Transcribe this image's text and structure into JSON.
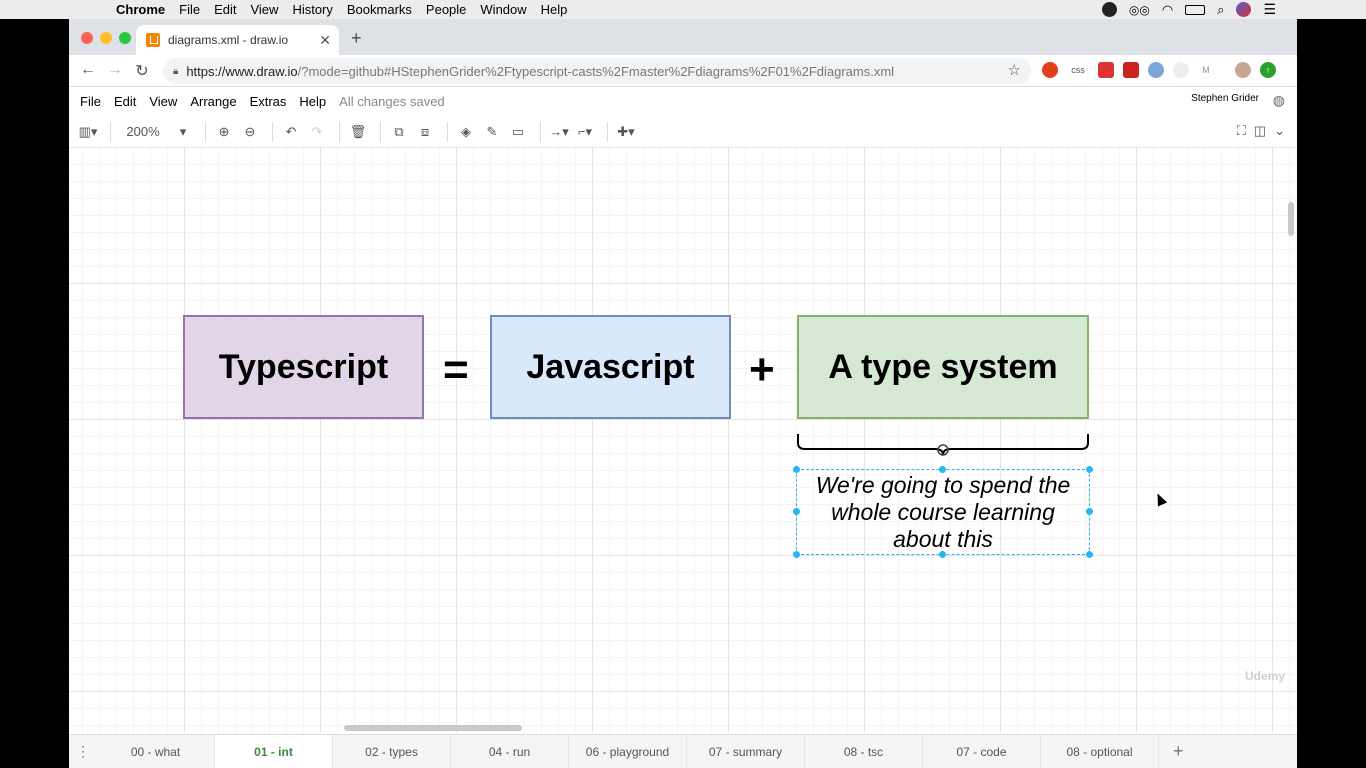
{
  "os_menubar": {
    "app": "Chrome",
    "items": [
      "File",
      "Edit",
      "View",
      "History",
      "Bookmarks",
      "People",
      "Window",
      "Help"
    ]
  },
  "browser": {
    "tab_title": "diagrams.xml - draw.io",
    "url_host": "https://www.draw.io",
    "url_rest": "/?mode=github#HStephenGrider%2Ftypescript-casts%2Fmaster%2Fdiagrams%2F01%2Fdiagrams.xml"
  },
  "drawio": {
    "menu": [
      "File",
      "Edit",
      "View",
      "Arrange",
      "Extras",
      "Help"
    ],
    "status": "All changes saved",
    "user": "Stephen Grider",
    "zoom": "200%"
  },
  "diagram": {
    "box1": "Typescript",
    "eq": "=",
    "box2": "Javascript",
    "plus": "+",
    "box3": "A type system",
    "note_line1": "We're going to spend the",
    "note_line2": "whole course learning",
    "note_line3": "about this",
    "colors": {
      "ts_fill": "#e1d5e7",
      "ts_stroke": "#9673a6",
      "js_fill": "#dae8fc",
      "js_stroke": "#6c8ebf",
      "ty_fill": "#d5e8d4",
      "ty_stroke": "#82b366",
      "selection": "#29b6f2"
    }
  },
  "pages": [
    "00 - what",
    "01 - int",
    "02 - types",
    "04 - run",
    "06 - playground",
    "07 - summary",
    "08 - tsc",
    "07 - code",
    "08 - optional"
  ],
  "active_page": "01 - int",
  "watermark": "Udemy"
}
